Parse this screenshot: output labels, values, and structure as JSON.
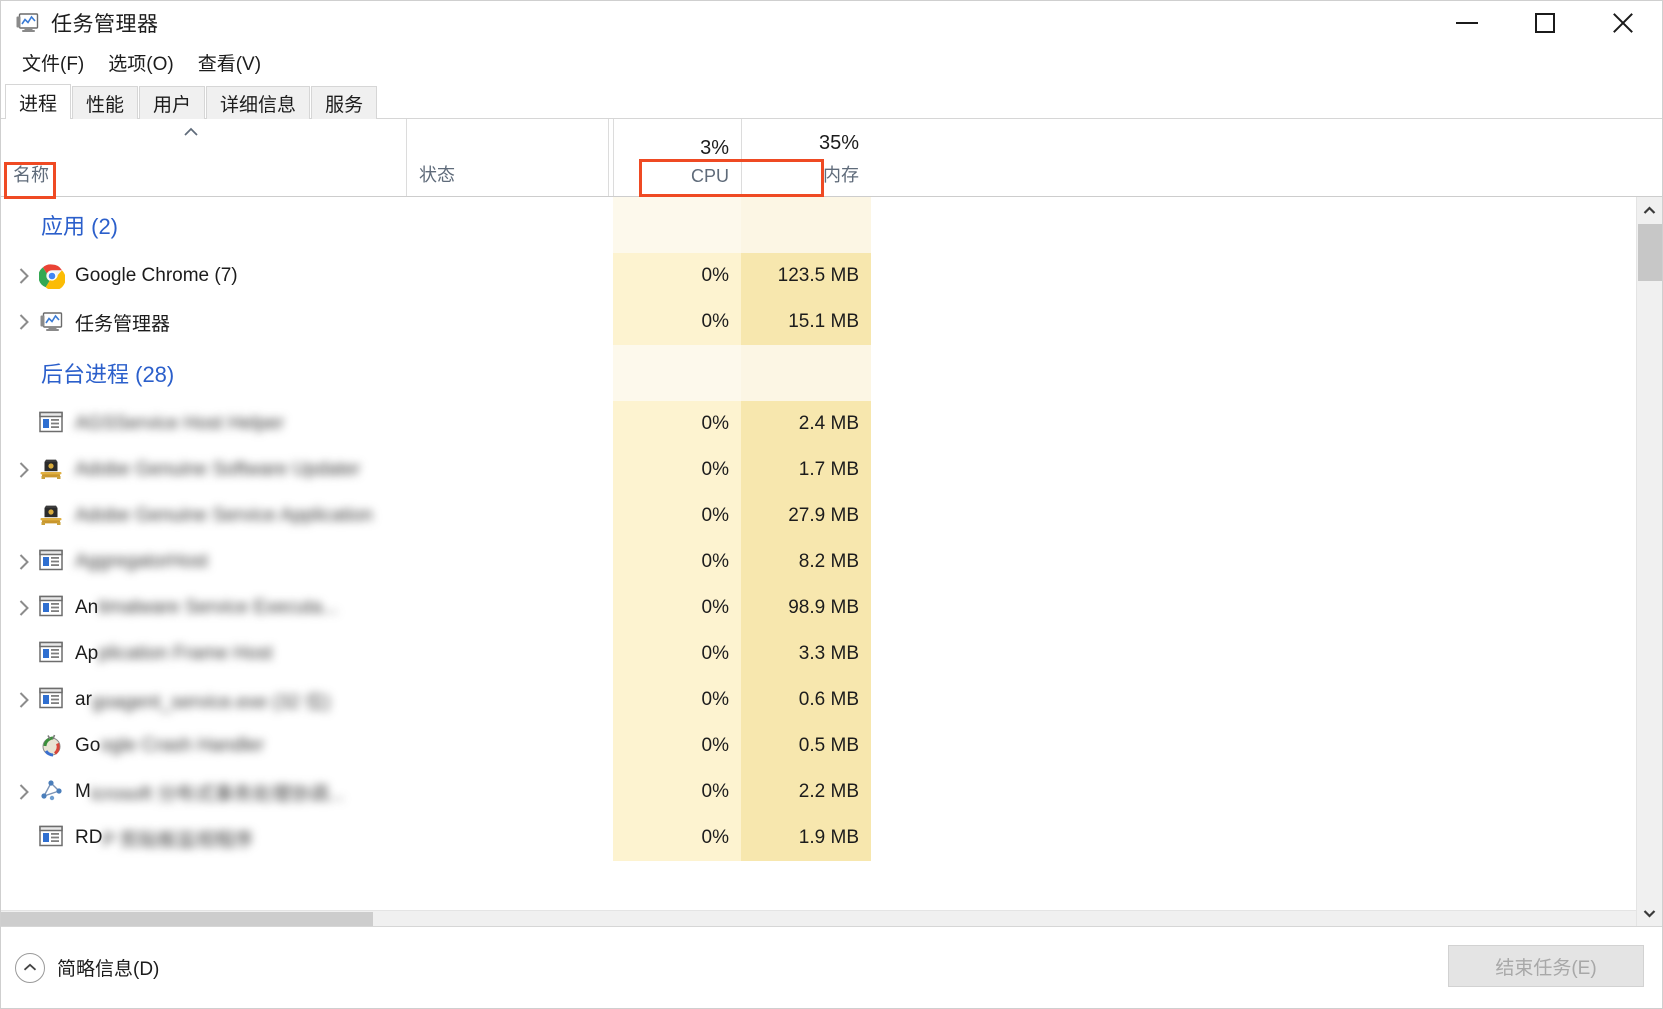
{
  "window": {
    "title": "任务管理器",
    "icon": "task-manager-icon",
    "controls": {
      "minimize": "—",
      "maximize": "▢",
      "close": "✕"
    }
  },
  "menu": [
    {
      "label": "文件(F)",
      "name": "menu-file"
    },
    {
      "label": "选项(O)",
      "name": "menu-options"
    },
    {
      "label": "查看(V)",
      "name": "menu-view"
    }
  ],
  "tabs": [
    {
      "label": "进程",
      "active": true
    },
    {
      "label": "性能",
      "active": false
    },
    {
      "label": "用户",
      "active": false
    },
    {
      "label": "详细信息",
      "active": false
    },
    {
      "label": "服务",
      "active": false
    }
  ],
  "columns": {
    "name": {
      "label": "名称",
      "pct": ""
    },
    "status": {
      "label": "状态",
      "pct": ""
    },
    "cpu": {
      "label": "CPU",
      "pct": "3%"
    },
    "memory": {
      "label": "内存",
      "pct": "35%"
    }
  },
  "highlight_color": "#ef4a23",
  "groups": [
    {
      "title": "应用 (2)",
      "cpu": "",
      "memory": "",
      "rows": [
        {
          "expander": true,
          "icon": "chrome-icon",
          "lead": "",
          "name": "Google Chrome (7)",
          "blurred": false,
          "status": "",
          "cpu": "0%",
          "memory": "123.5 MB"
        },
        {
          "expander": true,
          "icon": "task-manager-icon",
          "lead": "",
          "name": "任务管理器",
          "blurred": false,
          "status": "",
          "cpu": "0%",
          "memory": "15.1 MB"
        }
      ]
    },
    {
      "title": "后台进程 (28)",
      "cpu": "",
      "memory": "",
      "rows": [
        {
          "expander": false,
          "icon": "window-app-icon",
          "lead": "",
          "name": "AGSService Host Helper",
          "blurred": true,
          "status": "",
          "cpu": "0%",
          "memory": "2.4 MB"
        },
        {
          "expander": true,
          "icon": "shield-gold-icon",
          "lead": "",
          "name": "Adobe Genuine Software Updater",
          "blurred": true,
          "status": "",
          "cpu": "0%",
          "memory": "1.7 MB"
        },
        {
          "expander": false,
          "icon": "shield-gold-icon",
          "lead": "",
          "name": "Adobe Genuine Service Application",
          "blurred": true,
          "status": "",
          "cpu": "0%",
          "memory": "27.9 MB"
        },
        {
          "expander": true,
          "icon": "window-app-icon",
          "lead": "",
          "name": "AggregatorHost",
          "blurred": true,
          "status": "",
          "cpu": "0%",
          "memory": "8.2 MB"
        },
        {
          "expander": true,
          "icon": "window-app-icon",
          "lead": "An",
          "name": "timalware Service Executa...",
          "blurred": true,
          "status": "",
          "cpu": "0%",
          "memory": "98.9 MB"
        },
        {
          "expander": false,
          "icon": "window-app-icon",
          "lead": "Ap",
          "name": "plication Frame Host",
          "blurred": true,
          "status": "",
          "cpu": "0%",
          "memory": "3.3 MB"
        },
        {
          "expander": true,
          "icon": "window-app-icon",
          "lead": "ar",
          "name": "goagent_service.exe (32 位)",
          "blurred": true,
          "status": "",
          "cpu": "0%",
          "memory": "0.6 MB"
        },
        {
          "expander": false,
          "icon": "crash-handler-icon",
          "lead": "Go",
          "name": "ogle Crash Handler",
          "blurred": true,
          "status": "",
          "cpu": "0%",
          "memory": "0.5 MB"
        },
        {
          "expander": true,
          "icon": "network-icon",
          "lead": "M",
          "name": "icrosoft 分布式事务处理协调...",
          "blurred": true,
          "status": "",
          "cpu": "0%",
          "memory": "2.2 MB"
        },
        {
          "expander": false,
          "icon": "window-app-icon",
          "lead": "RD",
          "name": "P 剪贴板监视程序",
          "blurred": true,
          "status": "",
          "cpu": "0%",
          "memory": "1.9 MB"
        }
      ]
    }
  ],
  "scrollbar": {
    "up_arrow": "▲",
    "down_arrow": "▼"
  },
  "statusbar": {
    "fewer_details": "简略信息(D)",
    "fewer_icon": "chevron-up-circle-icon",
    "end_task": "结束任务(E)",
    "end_task_disabled": true
  }
}
